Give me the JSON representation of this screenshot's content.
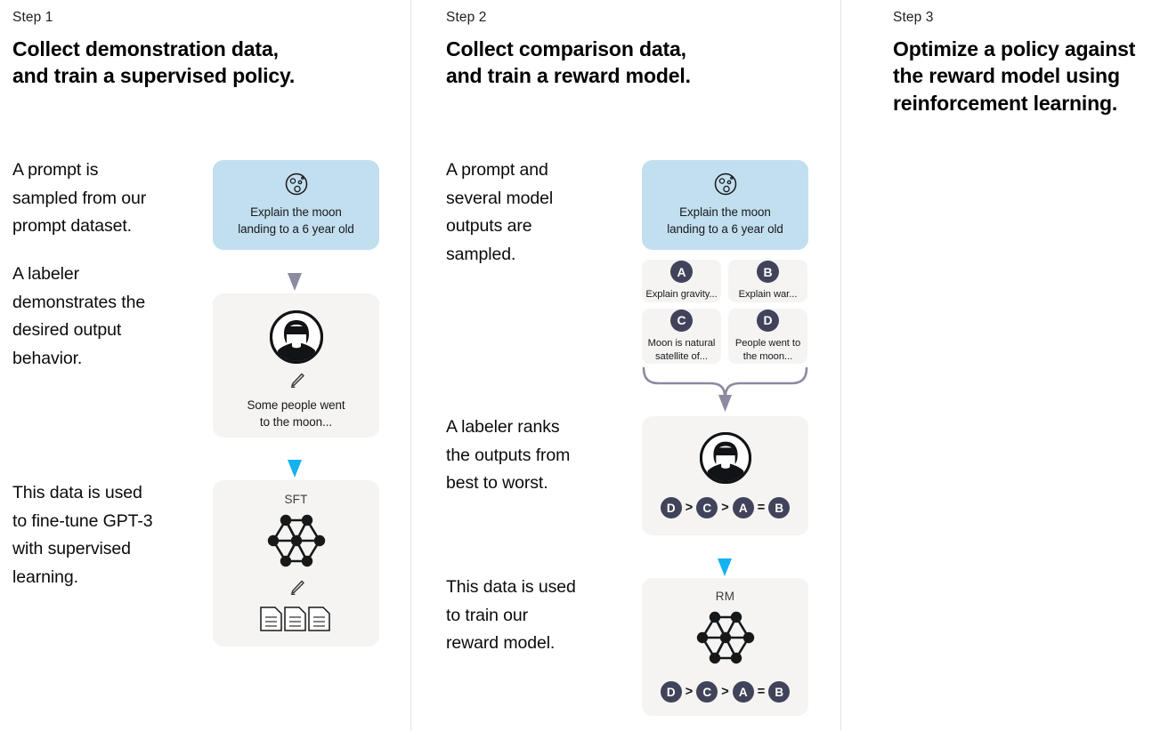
{
  "colors": {
    "prompt_card_bg": "#c2dff0",
    "card_bg": "#f5f4f2",
    "divider": "#e3e3e3",
    "badge_bg": "#40435a",
    "arrow_gray": "#8a8aa0",
    "arrow_blue": "#14b2f0",
    "text": "#000000"
  },
  "columns": [
    {
      "step_label": "Step 1",
      "title": "Collect demonstration data,\nand train a supervised policy.",
      "paragraphs": [
        "A prompt is\nsampled from our\nprompt dataset.",
        "A labeler\ndemonstrates the\ndesired output\nbehavior.",
        "This data is used\nto fine-tune GPT-3\nwith supervised\nlearning."
      ],
      "prompt_card": {
        "icon": "moon-icon",
        "text": "Explain the moon\nlanding to a 6 year old"
      },
      "demo_card": {
        "icon": "labeler-avatar-icon",
        "pencil": "pencil-icon",
        "text": "Some people went\nto the moon..."
      },
      "model_card": {
        "title": "SFT",
        "network": "neural-network-icon",
        "pencil": "pencil-icon",
        "documents": "documents-icon"
      },
      "arrows": [
        {
          "name": "arrow-prompt-to-demo",
          "color": "gray"
        },
        {
          "name": "arrow-demo-to-sft",
          "color": "blue"
        }
      ]
    },
    {
      "step_label": "Step 2",
      "title": "Collect comparison data,\nand train a reward model.",
      "paragraphs": [
        "A prompt and\nseveral model\noutputs are\nsampled.",
        "A labeler ranks\nthe outputs from\nbest to worst.",
        "This data is used\nto train our\nreward model."
      ],
      "prompt_card": {
        "icon": "moon-icon",
        "text": "Explain the moon\nlanding to a 6 year old"
      },
      "outputs": [
        {
          "badge": "A",
          "text": "Explain gravity..."
        },
        {
          "badge": "B",
          "text": "Explain war..."
        },
        {
          "badge": "C",
          "text": "Moon is natural\nsatellite of..."
        },
        {
          "badge": "D",
          "text": "People went to\nthe moon..."
        }
      ],
      "rank_card": {
        "icon": "labeler-avatar-icon",
        "ranking": [
          "D",
          ">",
          "C",
          ">",
          "A",
          "=",
          "B"
        ]
      },
      "model_card": {
        "title": "RM",
        "network": "neural-network-icon",
        "ranking": [
          "D",
          ">",
          "C",
          ">",
          "A",
          "=",
          "B"
        ]
      },
      "arrows": [
        {
          "name": "brace-outputs-to-rank",
          "color": "gray"
        },
        {
          "name": "arrow-rank-to-rm",
          "color": "blue"
        }
      ]
    },
    {
      "step_label": "Step 3",
      "title": "Optimize a policy against\nthe reward model using\nreinforcement learning.",
      "paragraphs": []
    }
  ]
}
